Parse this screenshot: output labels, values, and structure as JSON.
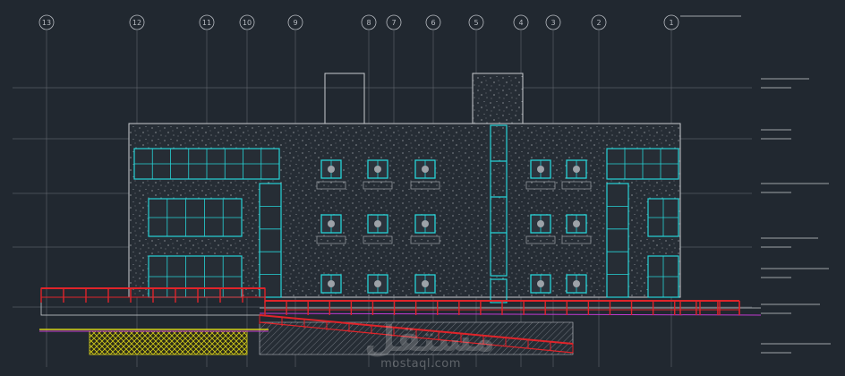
{
  "app": {
    "kind": "cad-drawing-viewport"
  },
  "drawing": {
    "type": "building-elevation",
    "grid_axes": [
      "13",
      "12",
      "11",
      "10",
      "9",
      "8",
      "7",
      "6",
      "5",
      "4",
      "3",
      "2",
      "1"
    ]
  },
  "colors": {
    "background": "#212830",
    "linework": "#c9ccd0",
    "glazing": "#27d3d6",
    "railing": "#e0242a",
    "hatch_yellow": "#d9d21a",
    "magenta": "#c23ad1"
  },
  "watermark": {
    "brand": "مستقل",
    "url": "mostaql.com"
  }
}
